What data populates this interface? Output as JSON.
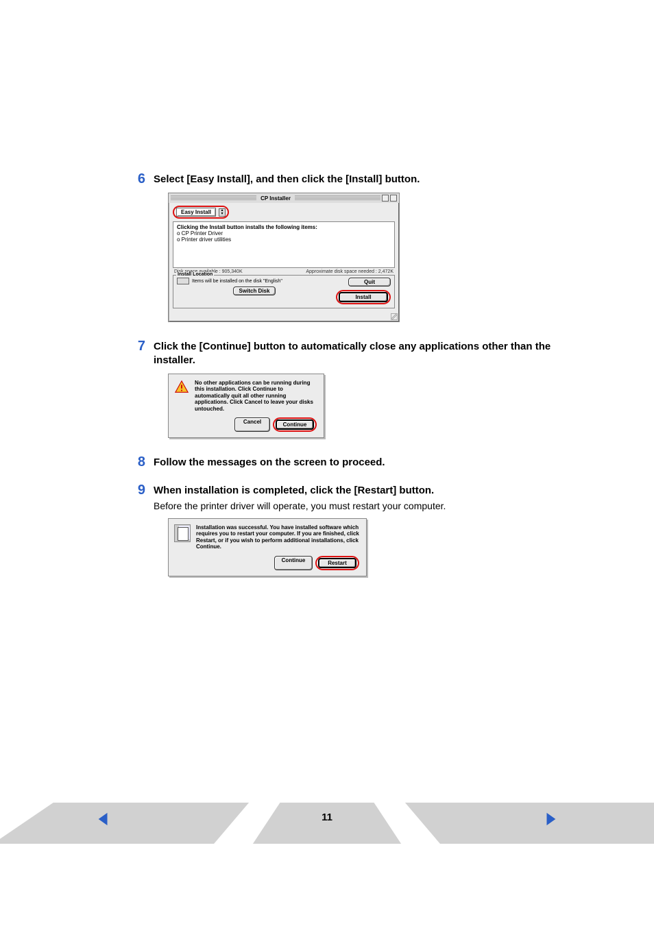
{
  "steps": {
    "s6": {
      "num": "6",
      "text": "Select [Easy Install], and then click the [Install] button."
    },
    "s7": {
      "num": "7",
      "text": "Click the [Continue] button to automatically close any applications other than the installer."
    },
    "s8": {
      "num": "8",
      "text": "Follow the messages on the screen to proceed."
    },
    "s9": {
      "num": "9",
      "text": "When installation is completed, click the [Restart] button.",
      "sub": "Before the printer driver will operate, you must restart your computer."
    }
  },
  "installer": {
    "title": "CP Installer",
    "dropdown": "Easy Install",
    "list_header": "Clicking the Install button installs the following items:",
    "items": [
      "o CP Printer Driver",
      "o Printer driver utilities"
    ],
    "disk_avail": "Disk space available : 905,340K",
    "disk_need": "Approximate disk space needed : 2,472K",
    "loc_legend": "Install Location",
    "loc_text": "Items will be installed on the disk \"English\"",
    "btn_switch": "Switch Disk",
    "btn_quit": "Quit",
    "btn_install": "Install"
  },
  "dialog_continue": {
    "text": "No other applications can be running during this installation. Click Continue to automatically quit all other running applications. Click Cancel to leave your disks untouched.",
    "btn_cancel": "Cancel",
    "btn_continue": "Continue"
  },
  "dialog_restart": {
    "text": "Installation was successful. You have installed software which requires you to restart your computer. If you are finished, click Restart, or if you wish to perform additional installations, click Continue.",
    "btn_continue": "Continue",
    "btn_restart": "Restart"
  },
  "footer": {
    "page": "11"
  }
}
